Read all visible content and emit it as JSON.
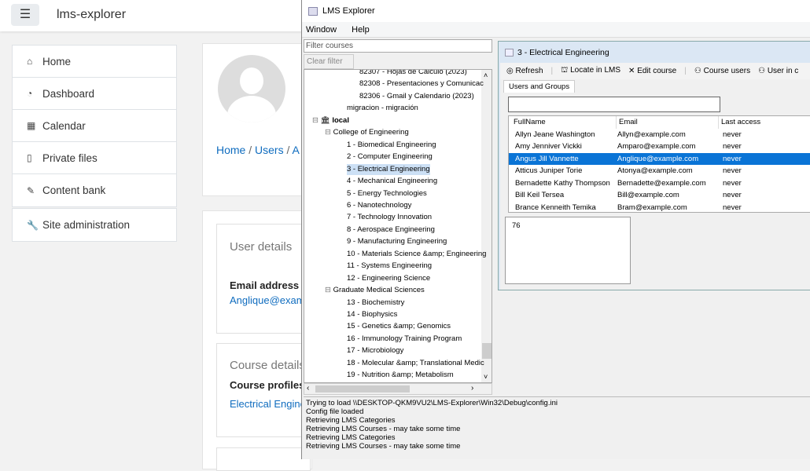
{
  "browser": {
    "site_name": "lms-explorer",
    "menu_icon": "hamburger-icon",
    "nav": [
      {
        "label": "Home",
        "icon": "home-icon"
      },
      {
        "label": "Dashboard",
        "icon": "dashboard-icon"
      },
      {
        "label": "Calendar",
        "icon": "calendar-icon"
      },
      {
        "label": "Private files",
        "icon": "file-icon"
      },
      {
        "label": "Content bank",
        "icon": "brush-icon"
      }
    ],
    "site_admin": {
      "label": "Site administration",
      "icon": "wrench-icon"
    },
    "breadcrumb": [
      "Home",
      "Users",
      "A"
    ],
    "user_details": {
      "heading": "User details",
      "email_label": "Email address",
      "email": "Anglique@exam"
    },
    "course_details": {
      "heading": "Course details",
      "profiles_label": "Course profiles",
      "course": "Electrical Engine"
    }
  },
  "app": {
    "title": "LMS Explorer",
    "menu": [
      "Window",
      "Help"
    ],
    "filter_placeholder": "Filter courses",
    "clear_filter": "Clear filter",
    "tree": [
      {
        "label": "82307 - Hojas de Cálculo (2023)",
        "level": 3
      },
      {
        "label": "82308 - Presentaciones y Comunicac",
        "level": 3
      },
      {
        "label": "82306 - Gmail y Calendario (2023)",
        "level": 3
      },
      {
        "label": "migracion - migración",
        "level": 2
      },
      {
        "label": "local",
        "level": 0,
        "bold": true,
        "icon": "institution-icon"
      },
      {
        "label": "College of Engineering",
        "level": 1,
        "expanded": true
      },
      {
        "label": "1 - Biomedical Engineering",
        "level": 2
      },
      {
        "label": "2 - Computer Engineering",
        "level": 2
      },
      {
        "label": "3 - Electrical Engineering",
        "level": 2,
        "selected": true
      },
      {
        "label": "4 - Mechanical Engineering",
        "level": 2
      },
      {
        "label": "5 - Energy Technologies",
        "level": 2
      },
      {
        "label": "6 - Nanotechnology",
        "level": 2
      },
      {
        "label": "7 - Technology Innovation",
        "level": 2
      },
      {
        "label": "8 - Aerospace Engineering",
        "level": 2
      },
      {
        "label": "9 - Manufacturing Engineering",
        "level": 2
      },
      {
        "label": "10 - Materials Science &amp; Engineering",
        "level": 2
      },
      {
        "label": "11 - Systems Engineering",
        "level": 2
      },
      {
        "label": "12 - Engineering Science",
        "level": 2
      },
      {
        "label": "Graduate Medical Sciences",
        "level": 1,
        "expanded": true
      },
      {
        "label": "13 - Biochemistry",
        "level": 2
      },
      {
        "label": "14 - Biophysics",
        "level": 2
      },
      {
        "label": "15 - Genetics &amp; Genomics",
        "level": 2
      },
      {
        "label": "16 - Immunology Training Program",
        "level": 2
      },
      {
        "label": "17 - Microbiology",
        "level": 2
      },
      {
        "label": "18 - Molecular &amp; Translational Medic",
        "level": 2
      },
      {
        "label": "19 - Nutrition &amp; Metabolism",
        "level": 2
      }
    ],
    "course_window": {
      "title": "3 - Electrical Engineering",
      "toolbar": [
        "Refresh",
        "Locate in LMS",
        "Edit course",
        "Course users",
        "User in c"
      ],
      "tab": "Users and Groups",
      "search_value": "",
      "columns": [
        "FullName",
        "Email",
        "Last access"
      ],
      "rows": [
        [
          "Allyn Jeane Washington",
          "Allyn@example.com",
          "never"
        ],
        [
          "Amy Jenniver Vickki",
          "Amparo@example.com",
          "never"
        ],
        [
          "Angus Jill Vannette",
          "Anglique@example.com",
          "never"
        ],
        [
          "Atticus Juniper Torie",
          "Atonya@example.com",
          "never"
        ],
        [
          "Bernadette Kathy Thompson",
          "Bernadette@example.com",
          "never"
        ],
        [
          "Bill Keil Tersea",
          "Bill@example.com",
          "never"
        ],
        [
          "Brance Kenneith Temika",
          "Bram@example.com",
          "never"
        ]
      ],
      "selected_row": 2,
      "detail": "76"
    },
    "log": [
      "Trying to load \\\\DESKTOP-QKM9VU2\\LMS-Explorer\\Win32\\Debug\\config.ini",
      "Config file loaded",
      "Retrieving LMS Categories",
      "Retrieving LMS Courses - may take some time",
      "Retrieving LMS Categories",
      "Retrieving LMS Courses - may take some time"
    ],
    "colors": {
      "selection": "#0a74d6",
      "link": "#0f6cbf"
    }
  }
}
